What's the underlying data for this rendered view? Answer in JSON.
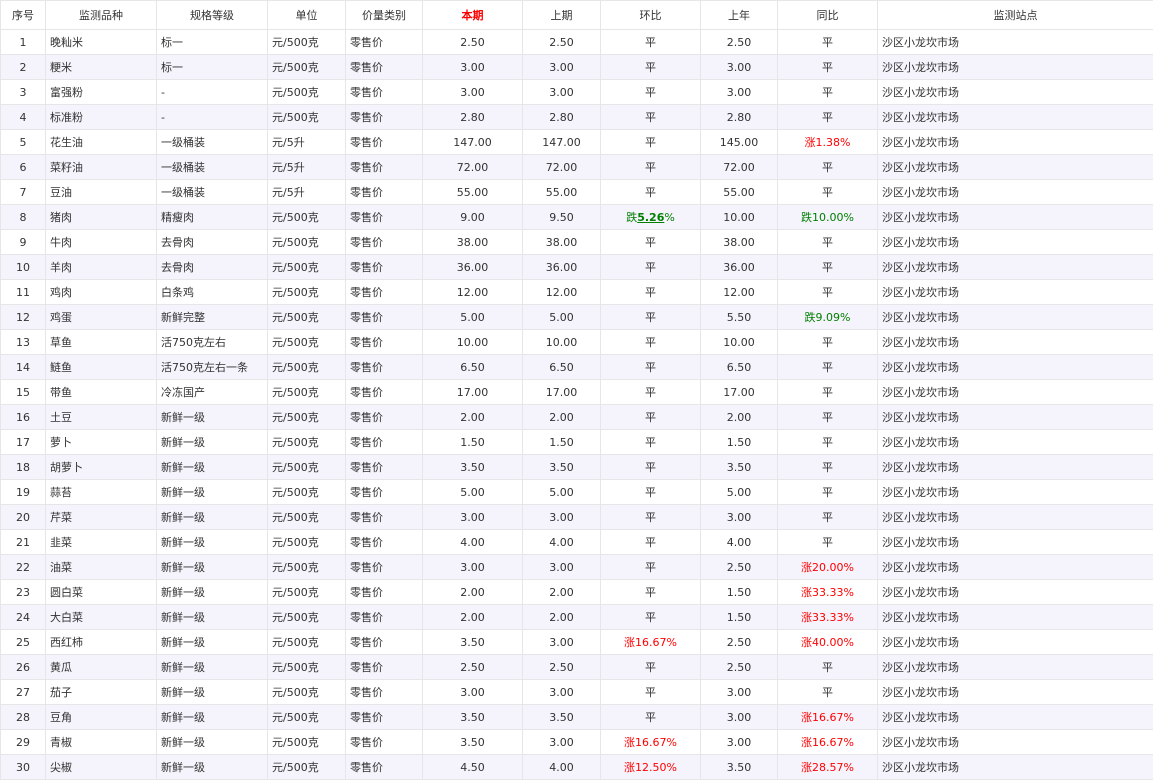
{
  "headers": [
    "序号",
    "监测品种",
    "规格等级",
    "单位",
    "价量类别",
    "本期",
    "上期",
    "环比",
    "上年",
    "同比",
    "监测站点"
  ],
  "rows": [
    {
      "no": "1",
      "item": "晚籼米",
      "grade": "标一",
      "unit": "元/500克",
      "type": "零售价",
      "cur": "2.50",
      "prev": "2.50",
      "mom": {
        "text": "平",
        "dir": "flat"
      },
      "lastyear": "2.50",
      "yoy": {
        "text": "平",
        "dir": "flat"
      },
      "station": "沙区小龙坎市场"
    },
    {
      "no": "2",
      "item": "粳米",
      "grade": "标一",
      "unit": "元/500克",
      "type": "零售价",
      "cur": "3.00",
      "prev": "3.00",
      "mom": {
        "text": "平",
        "dir": "flat"
      },
      "lastyear": "3.00",
      "yoy": {
        "text": "平",
        "dir": "flat"
      },
      "station": "沙区小龙坎市场"
    },
    {
      "no": "3",
      "item": "富强粉",
      "grade": "-",
      "unit": "元/500克",
      "type": "零售价",
      "cur": "3.00",
      "prev": "3.00",
      "mom": {
        "text": "平",
        "dir": "flat"
      },
      "lastyear": "3.00",
      "yoy": {
        "text": "平",
        "dir": "flat"
      },
      "station": "沙区小龙坎市场"
    },
    {
      "no": "4",
      "item": "标准粉",
      "grade": "-",
      "unit": "元/500克",
      "type": "零售价",
      "cur": "2.80",
      "prev": "2.80",
      "mom": {
        "text": "平",
        "dir": "flat"
      },
      "lastyear": "2.80",
      "yoy": {
        "text": "平",
        "dir": "flat"
      },
      "station": "沙区小龙坎市场"
    },
    {
      "no": "5",
      "item": "花生油",
      "grade": "一级桶装",
      "unit": "元/5升",
      "type": "零售价",
      "cur": "147.00",
      "prev": "147.00",
      "mom": {
        "text": "平",
        "dir": "flat"
      },
      "lastyear": "145.00",
      "yoy": {
        "text": "涨1.38%",
        "dir": "up"
      },
      "station": "沙区小龙坎市场"
    },
    {
      "no": "6",
      "item": "菜籽油",
      "grade": "一级桶装",
      "unit": "元/5升",
      "type": "零售价",
      "cur": "72.00",
      "prev": "72.00",
      "mom": {
        "text": "平",
        "dir": "flat"
      },
      "lastyear": "72.00",
      "yoy": {
        "text": "平",
        "dir": "flat"
      },
      "station": "沙区小龙坎市场"
    },
    {
      "no": "7",
      "item": "豆油",
      "grade": "一级桶装",
      "unit": "元/5升",
      "type": "零售价",
      "cur": "55.00",
      "prev": "55.00",
      "mom": {
        "text": "平",
        "dir": "flat"
      },
      "lastyear": "55.00",
      "yoy": {
        "text": "平",
        "dir": "flat"
      },
      "station": "沙区小龙坎市场"
    },
    {
      "no": "8",
      "item": "猪肉",
      "grade": "精瘦肉",
      "unit": "元/500克",
      "type": "零售价",
      "cur": "9.00",
      "prev": "9.50",
      "mom": {
        "text": "跌",
        "num": "5.26",
        "suffix": "%",
        "dir": "down"
      },
      "lastyear": "10.00",
      "yoy": {
        "text": "跌10.00%",
        "dir": "down"
      },
      "station": "沙区小龙坎市场"
    },
    {
      "no": "9",
      "item": "牛肉",
      "grade": "去骨肉",
      "unit": "元/500克",
      "type": "零售价",
      "cur": "38.00",
      "prev": "38.00",
      "mom": {
        "text": "平",
        "dir": "flat"
      },
      "lastyear": "38.00",
      "yoy": {
        "text": "平",
        "dir": "flat"
      },
      "station": "沙区小龙坎市场"
    },
    {
      "no": "10",
      "item": "羊肉",
      "grade": "去骨肉",
      "unit": "元/500克",
      "type": "零售价",
      "cur": "36.00",
      "prev": "36.00",
      "mom": {
        "text": "平",
        "dir": "flat"
      },
      "lastyear": "36.00",
      "yoy": {
        "text": "平",
        "dir": "flat"
      },
      "station": "沙区小龙坎市场"
    },
    {
      "no": "11",
      "item": "鸡肉",
      "grade": "白条鸡",
      "unit": "元/500克",
      "type": "零售价",
      "cur": "12.00",
      "prev": "12.00",
      "mom": {
        "text": "平",
        "dir": "flat"
      },
      "lastyear": "12.00",
      "yoy": {
        "text": "平",
        "dir": "flat"
      },
      "station": "沙区小龙坎市场"
    },
    {
      "no": "12",
      "item": "鸡蛋",
      "grade": "新鲜完整",
      "unit": "元/500克",
      "type": "零售价",
      "cur": "5.00",
      "prev": "5.00",
      "mom": {
        "text": "平",
        "dir": "flat"
      },
      "lastyear": "5.50",
      "yoy": {
        "text": "跌9.09%",
        "dir": "down"
      },
      "station": "沙区小龙坎市场"
    },
    {
      "no": "13",
      "item": "草鱼",
      "grade": "活750克左右",
      "unit": "元/500克",
      "type": "零售价",
      "cur": "10.00",
      "prev": "10.00",
      "mom": {
        "text": "平",
        "dir": "flat"
      },
      "lastyear": "10.00",
      "yoy": {
        "text": "平",
        "dir": "flat"
      },
      "station": "沙区小龙坎市场"
    },
    {
      "no": "14",
      "item": "鲢鱼",
      "grade": "活750克左右一条",
      "unit": "元/500克",
      "type": "零售价",
      "cur": "6.50",
      "prev": "6.50",
      "mom": {
        "text": "平",
        "dir": "flat"
      },
      "lastyear": "6.50",
      "yoy": {
        "text": "平",
        "dir": "flat"
      },
      "station": "沙区小龙坎市场"
    },
    {
      "no": "15",
      "item": "带鱼",
      "grade": "冷冻国产",
      "unit": "元/500克",
      "type": "零售价",
      "cur": "17.00",
      "prev": "17.00",
      "mom": {
        "text": "平",
        "dir": "flat"
      },
      "lastyear": "17.00",
      "yoy": {
        "text": "平",
        "dir": "flat"
      },
      "station": "沙区小龙坎市场"
    },
    {
      "no": "16",
      "item": "土豆",
      "grade": "新鲜一级",
      "unit": "元/500克",
      "type": "零售价",
      "cur": "2.00",
      "prev": "2.00",
      "mom": {
        "text": "平",
        "dir": "flat"
      },
      "lastyear": "2.00",
      "yoy": {
        "text": "平",
        "dir": "flat"
      },
      "station": "沙区小龙坎市场"
    },
    {
      "no": "17",
      "item": "萝卜",
      "grade": "新鲜一级",
      "unit": "元/500克",
      "type": "零售价",
      "cur": "1.50",
      "prev": "1.50",
      "mom": {
        "text": "平",
        "dir": "flat"
      },
      "lastyear": "1.50",
      "yoy": {
        "text": "平",
        "dir": "flat"
      },
      "station": "沙区小龙坎市场"
    },
    {
      "no": "18",
      "item": "胡萝卜",
      "grade": "新鲜一级",
      "unit": "元/500克",
      "type": "零售价",
      "cur": "3.50",
      "prev": "3.50",
      "mom": {
        "text": "平",
        "dir": "flat"
      },
      "lastyear": "3.50",
      "yoy": {
        "text": "平",
        "dir": "flat"
      },
      "station": "沙区小龙坎市场"
    },
    {
      "no": "19",
      "item": "蒜苔",
      "grade": "新鲜一级",
      "unit": "元/500克",
      "type": "零售价",
      "cur": "5.00",
      "prev": "5.00",
      "mom": {
        "text": "平",
        "dir": "flat"
      },
      "lastyear": "5.00",
      "yoy": {
        "text": "平",
        "dir": "flat"
      },
      "station": "沙区小龙坎市场"
    },
    {
      "no": "20",
      "item": "芹菜",
      "grade": "新鲜一级",
      "unit": "元/500克",
      "type": "零售价",
      "cur": "3.00",
      "prev": "3.00",
      "mom": {
        "text": "平",
        "dir": "flat"
      },
      "lastyear": "3.00",
      "yoy": {
        "text": "平",
        "dir": "flat"
      },
      "station": "沙区小龙坎市场"
    },
    {
      "no": "21",
      "item": "韭菜",
      "grade": "新鲜一级",
      "unit": "元/500克",
      "type": "零售价",
      "cur": "4.00",
      "prev": "4.00",
      "mom": {
        "text": "平",
        "dir": "flat"
      },
      "lastyear": "4.00",
      "yoy": {
        "text": "平",
        "dir": "flat"
      },
      "station": "沙区小龙坎市场"
    },
    {
      "no": "22",
      "item": "油菜",
      "grade": "新鲜一级",
      "unit": "元/500克",
      "type": "零售价",
      "cur": "3.00",
      "prev": "3.00",
      "mom": {
        "text": "平",
        "dir": "flat"
      },
      "lastyear": "2.50",
      "yoy": {
        "text": "涨20.00%",
        "dir": "up"
      },
      "station": "沙区小龙坎市场"
    },
    {
      "no": "23",
      "item": "圆白菜",
      "grade": "新鲜一级",
      "unit": "元/500克",
      "type": "零售价",
      "cur": "2.00",
      "prev": "2.00",
      "mom": {
        "text": "平",
        "dir": "flat"
      },
      "lastyear": "1.50",
      "yoy": {
        "text": "涨33.33%",
        "dir": "up"
      },
      "station": "沙区小龙坎市场"
    },
    {
      "no": "24",
      "item": "大白菜",
      "grade": "新鲜一级",
      "unit": "元/500克",
      "type": "零售价",
      "cur": "2.00",
      "prev": "2.00",
      "mom": {
        "text": "平",
        "dir": "flat"
      },
      "lastyear": "1.50",
      "yoy": {
        "text": "涨33.33%",
        "dir": "up"
      },
      "station": "沙区小龙坎市场"
    },
    {
      "no": "25",
      "item": "西红柿",
      "grade": "新鲜一级",
      "unit": "元/500克",
      "type": "零售价",
      "cur": "3.50",
      "prev": "3.00",
      "mom": {
        "text": "涨16.67%",
        "dir": "up"
      },
      "lastyear": "2.50",
      "yoy": {
        "text": "涨40.00%",
        "dir": "up"
      },
      "station": "沙区小龙坎市场"
    },
    {
      "no": "26",
      "item": "黄瓜",
      "grade": "新鲜一级",
      "unit": "元/500克",
      "type": "零售价",
      "cur": "2.50",
      "prev": "2.50",
      "mom": {
        "text": "平",
        "dir": "flat"
      },
      "lastyear": "2.50",
      "yoy": {
        "text": "平",
        "dir": "flat"
      },
      "station": "沙区小龙坎市场"
    },
    {
      "no": "27",
      "item": "茄子",
      "grade": "新鲜一级",
      "unit": "元/500克",
      "type": "零售价",
      "cur": "3.00",
      "prev": "3.00",
      "mom": {
        "text": "平",
        "dir": "flat"
      },
      "lastyear": "3.00",
      "yoy": {
        "text": "平",
        "dir": "flat"
      },
      "station": "沙区小龙坎市场"
    },
    {
      "no": "28",
      "item": "豆角",
      "grade": "新鲜一级",
      "unit": "元/500克",
      "type": "零售价",
      "cur": "3.50",
      "prev": "3.50",
      "mom": {
        "text": "平",
        "dir": "flat"
      },
      "lastyear": "3.00",
      "yoy": {
        "text": "涨16.67%",
        "dir": "up"
      },
      "station": "沙区小龙坎市场"
    },
    {
      "no": "29",
      "item": "青椒",
      "grade": "新鲜一级",
      "unit": "元/500克",
      "type": "零售价",
      "cur": "3.50",
      "prev": "3.00",
      "mom": {
        "text": "涨16.67%",
        "dir": "up"
      },
      "lastyear": "3.00",
      "yoy": {
        "text": "涨16.67%",
        "dir": "up"
      },
      "station": "沙区小龙坎市场"
    },
    {
      "no": "30",
      "item": "尖椒",
      "grade": "新鲜一级",
      "unit": "元/500克",
      "type": "零售价",
      "cur": "4.50",
      "prev": "4.00",
      "mom": {
        "text": "涨12.50%",
        "dir": "up"
      },
      "lastyear": "3.50",
      "yoy": {
        "text": "涨28.57%",
        "dir": "up"
      },
      "station": "沙区小龙坎市场"
    }
  ],
  "colors": {
    "up": "#ff0000",
    "down": "#008000",
    "current_header": "#ff0000",
    "alt_row": "#f5f3fb",
    "border": "#e6e6e6"
  }
}
